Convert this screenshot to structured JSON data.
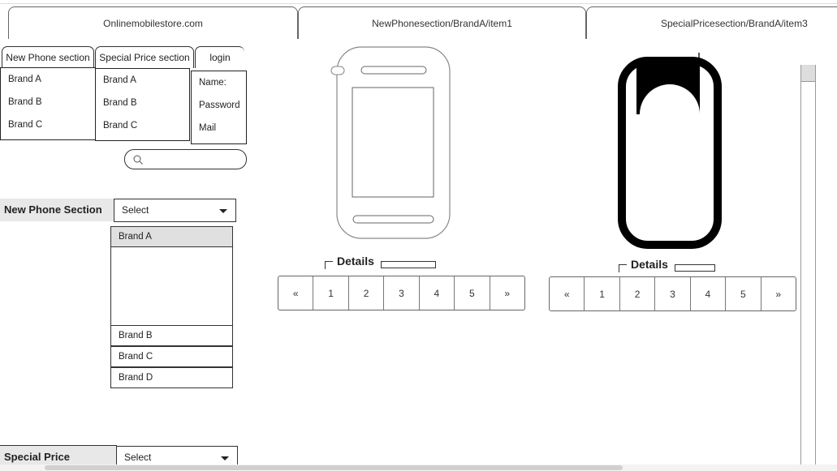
{
  "browser_tabs": [
    "Onlinemobilestore.com",
    "NewPhonesection/BrandA/item1",
    "SpecialPricesection/BrandA/item3"
  ],
  "sidebar_tabs": {
    "new_phone": "New Phone section",
    "special_price": "Special Price section",
    "login": "login"
  },
  "new_phone_brands": [
    "Brand A",
    "Brand B",
    "Brand C"
  ],
  "special_price_brands": [
    "Brand A",
    "Brand B",
    "Brand C"
  ],
  "login_fields": [
    "Name:",
    "Password",
    "Mail"
  ],
  "search": {
    "placeholder": "",
    "icon": "search-icon"
  },
  "new_phone_filter": {
    "label": "New Phone Section",
    "select_value": "Select",
    "options": [
      "Brand A",
      "Brand B",
      "Brand C",
      "Brand D"
    ]
  },
  "special_price_filter": {
    "label": "Special Price",
    "select_value": "Select"
  },
  "products": [
    {
      "details_label": "Details",
      "image": "phone-outline-icon"
    },
    {
      "details_label": "Details",
      "image": "phone-solid-icon"
    }
  ],
  "pagination": [
    "«",
    "1",
    "2",
    "3",
    "4",
    "5",
    "»"
  ]
}
